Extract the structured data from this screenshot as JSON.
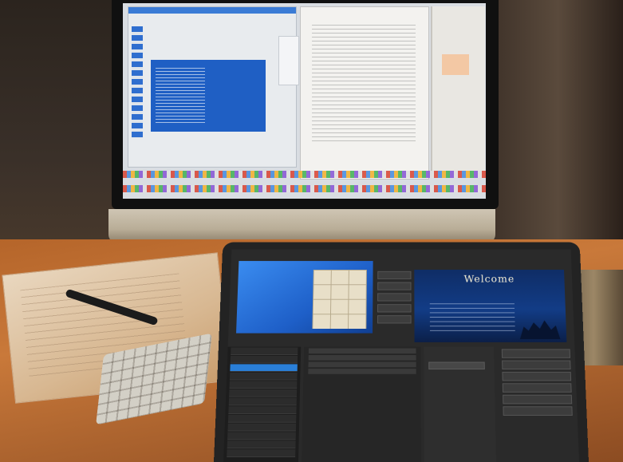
{
  "scene": {
    "palette": {
      "desk_wood": "#c9793a",
      "imac_chin": "#cfc6b4",
      "laptop_body": "#232323",
      "preview_blue": "#1e5fc8",
      "program_navy": "#123c86"
    }
  },
  "laptop": {
    "program": {
      "title": "Welcome"
    }
  },
  "icons": [
    "imac-screen",
    "laptop-screen",
    "keyboard",
    "pen",
    "cup"
  ]
}
